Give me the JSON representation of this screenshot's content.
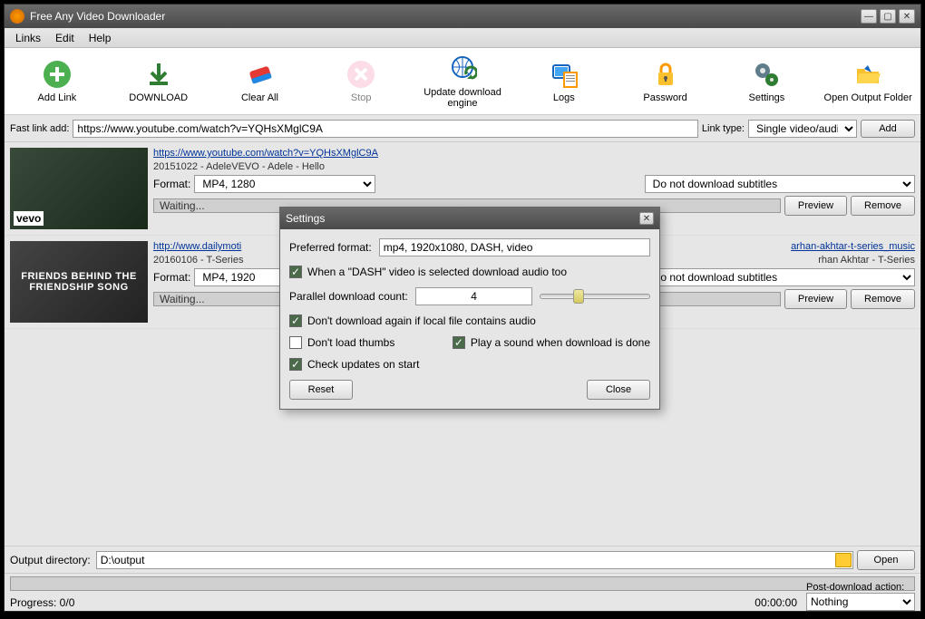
{
  "window": {
    "title": "Free Any Video Downloader"
  },
  "menubar": {
    "items": [
      "Links",
      "Edit",
      "Help"
    ]
  },
  "toolbar": {
    "buttons": [
      {
        "label": "Add Link",
        "icon": "plus"
      },
      {
        "label": "DOWNLOAD",
        "icon": "download"
      },
      {
        "label": "Clear All",
        "icon": "eraser"
      },
      {
        "label": "Stop",
        "icon": "stop",
        "disabled": true
      },
      {
        "label": "Update download engine",
        "icon": "globe-refresh"
      },
      {
        "label": "Logs",
        "icon": "logs"
      },
      {
        "label": "Password",
        "icon": "lock"
      },
      {
        "label": "Settings",
        "icon": "gears"
      },
      {
        "label": "Open Output Folder",
        "icon": "folder"
      }
    ]
  },
  "fastlink": {
    "label": "Fast link add:",
    "url": "https://www.youtube.com/watch?v=YQHsXMglC9A",
    "linktype_label": "Link type:",
    "linktype_value": "Single video/audio",
    "add_label": "Add"
  },
  "items": [
    {
      "thumb_watermark": "vevo",
      "link": "https://www.youtube.com/watch?v=YQHsXMglC9A",
      "meta": "20151022 - AdeleVEVO - Adele - Hello",
      "format_label": "Format:",
      "format_value": "MP4, 1280",
      "status": "Waiting...",
      "subtitles_value": "Do not download subtitles",
      "preview_label": "Preview",
      "remove_label": "Remove"
    },
    {
      "thumb_text": "FRIENDS BEHIND THE FRIENDSHIP SONG",
      "link_visible": "http://www.dailymoti",
      "link_suffix": "arhan-akhtar-t-series_music",
      "meta_prefix": "20160106 - T-Series",
      "meta_suffix": "rhan Akhtar - T-Series",
      "format_label": "Format:",
      "format_value": "MP4, 1920",
      "status": "Waiting...",
      "subtitles_value": "Do not download subtitles",
      "preview_label": "Preview",
      "remove_label": "Remove"
    }
  ],
  "output": {
    "label": "Output directory:",
    "value": "D:\\output",
    "open_label": "Open"
  },
  "status": {
    "progress_label": "Progress: 0/0",
    "time": "00:00:00",
    "postaction_label": "Post-download action:",
    "postaction_value": "Nothing"
  },
  "dialog": {
    "title": "Settings",
    "pref_format_label": "Preferred format:",
    "pref_format_value": "mp4, 1920x1080, DASH, video",
    "dash_audio_label": "When a \"DASH\" video is selected download audio too",
    "parallel_label": "Parallel download count:",
    "parallel_value": "4",
    "dont_download_again_label": "Don't download again if local file contains audio",
    "dont_load_thumbs_label": "Don't load thumbs",
    "play_sound_label": "Play a sound when download is done",
    "check_updates_label": "Check updates on start",
    "reset_label": "Reset",
    "close_label": "Close"
  }
}
